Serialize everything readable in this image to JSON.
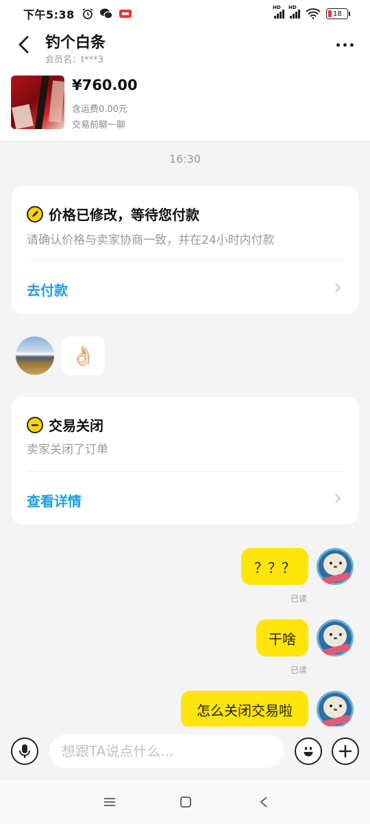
{
  "status_bar": {
    "time": "下午5:38",
    "network": "HD",
    "battery_level": "18",
    "colors": {
      "battery_low": "#ee3333"
    }
  },
  "header": {
    "title": "钓个白条",
    "subtitle": "会员名：t***3",
    "back_icon": "chevron-left-icon",
    "more_icon": "more-dots-icon"
  },
  "product": {
    "price": "¥760.00",
    "shipping": "含运费0.00元",
    "note": "交易前聊一聊"
  },
  "chat": {
    "timestamp": "16:30",
    "cards": [
      {
        "title": "价格已修改，等待您付款",
        "description": "请确认价格与卖家协商一致，并在24小时内付款",
        "action": "去付款",
        "icon": "pencil-badge-icon"
      },
      {
        "title": "交易关闭",
        "description": "卖家关闭了订单",
        "action": "查看详情",
        "icon": "minus-badge-icon"
      }
    ],
    "incoming_emoji": "👌🏻",
    "messages": [
      {
        "text": "？？？",
        "status": "已读"
      },
      {
        "text": "干啥",
        "status": "已读"
      },
      {
        "text": "怎么关闭交易啦",
        "status": ""
      }
    ],
    "colors": {
      "bubble": "#ffe50a",
      "link": "#1f9fe0",
      "accent": "#ffd400"
    }
  },
  "input": {
    "placeholder": "想跟TA说点什么...",
    "value": "",
    "voice_icon": "microphone-icon",
    "emoji_icon": "smiley-icon",
    "plus_icon": "plus-icon"
  },
  "nav": {
    "menu_icon": "menu-icon",
    "home_icon": "square-home-icon",
    "back_icon": "triangle-back-icon"
  }
}
